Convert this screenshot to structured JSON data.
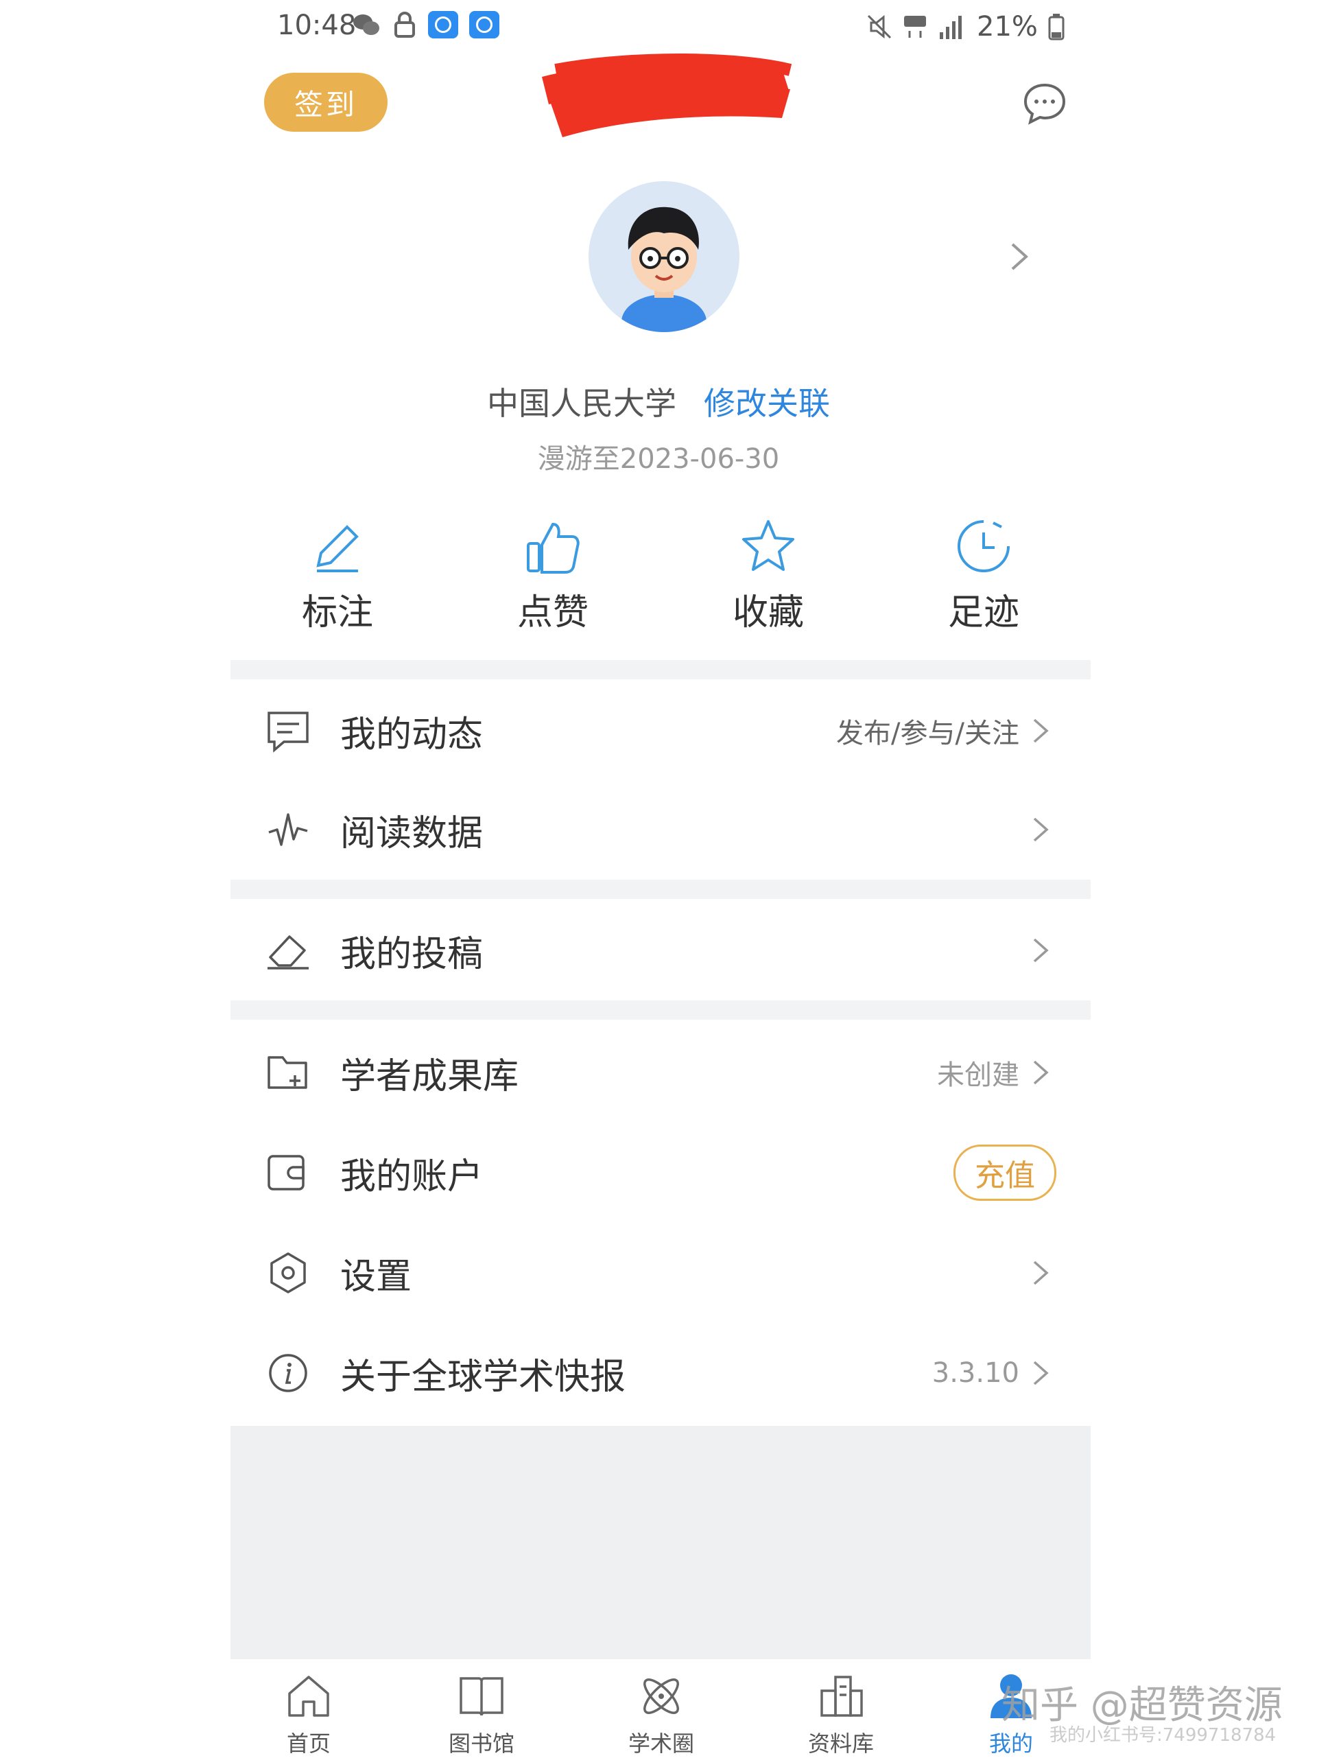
{
  "status_bar": {
    "time": "10:48",
    "battery": "21%"
  },
  "header": {
    "checkin_label": "签到"
  },
  "profile": {
    "school": "中国人民大学",
    "edit_link": "修改关联",
    "roam": "漫游至2023-06-30"
  },
  "quick_actions": [
    {
      "label": "标注",
      "icon": "pencil-icon"
    },
    {
      "label": "点赞",
      "icon": "thumbs-up-icon"
    },
    {
      "label": "收藏",
      "icon": "star-icon"
    },
    {
      "label": "足迹",
      "icon": "clock-icon"
    }
  ],
  "menu": {
    "dynamics": {
      "label": "我的动态",
      "right": "发布/参与/关注"
    },
    "reading": {
      "label": "阅读数据"
    },
    "submission": {
      "label": "我的投稿"
    },
    "scholar": {
      "label": "学者成果库",
      "right": "未创建"
    },
    "account": {
      "label": "我的账户",
      "right": "充值"
    },
    "settings": {
      "label": "设置"
    },
    "about": {
      "label": "关于全球学术快报",
      "right": "3.3.10"
    }
  },
  "bottom_nav": [
    {
      "label": "首页",
      "icon": "home-icon"
    },
    {
      "label": "图书馆",
      "icon": "book-icon"
    },
    {
      "label": "学术圈",
      "icon": "atom-icon"
    },
    {
      "label": "资料库",
      "icon": "building-icon"
    },
    {
      "label": "我的",
      "icon": "person-icon",
      "active": true
    }
  ],
  "watermark": {
    "main": "知乎 @超赞资源",
    "sub": "我的小红书号:7499718784"
  },
  "colors": {
    "accent": "#2e86de",
    "gold": "#e9b14f",
    "redaction": "#ee3322"
  }
}
